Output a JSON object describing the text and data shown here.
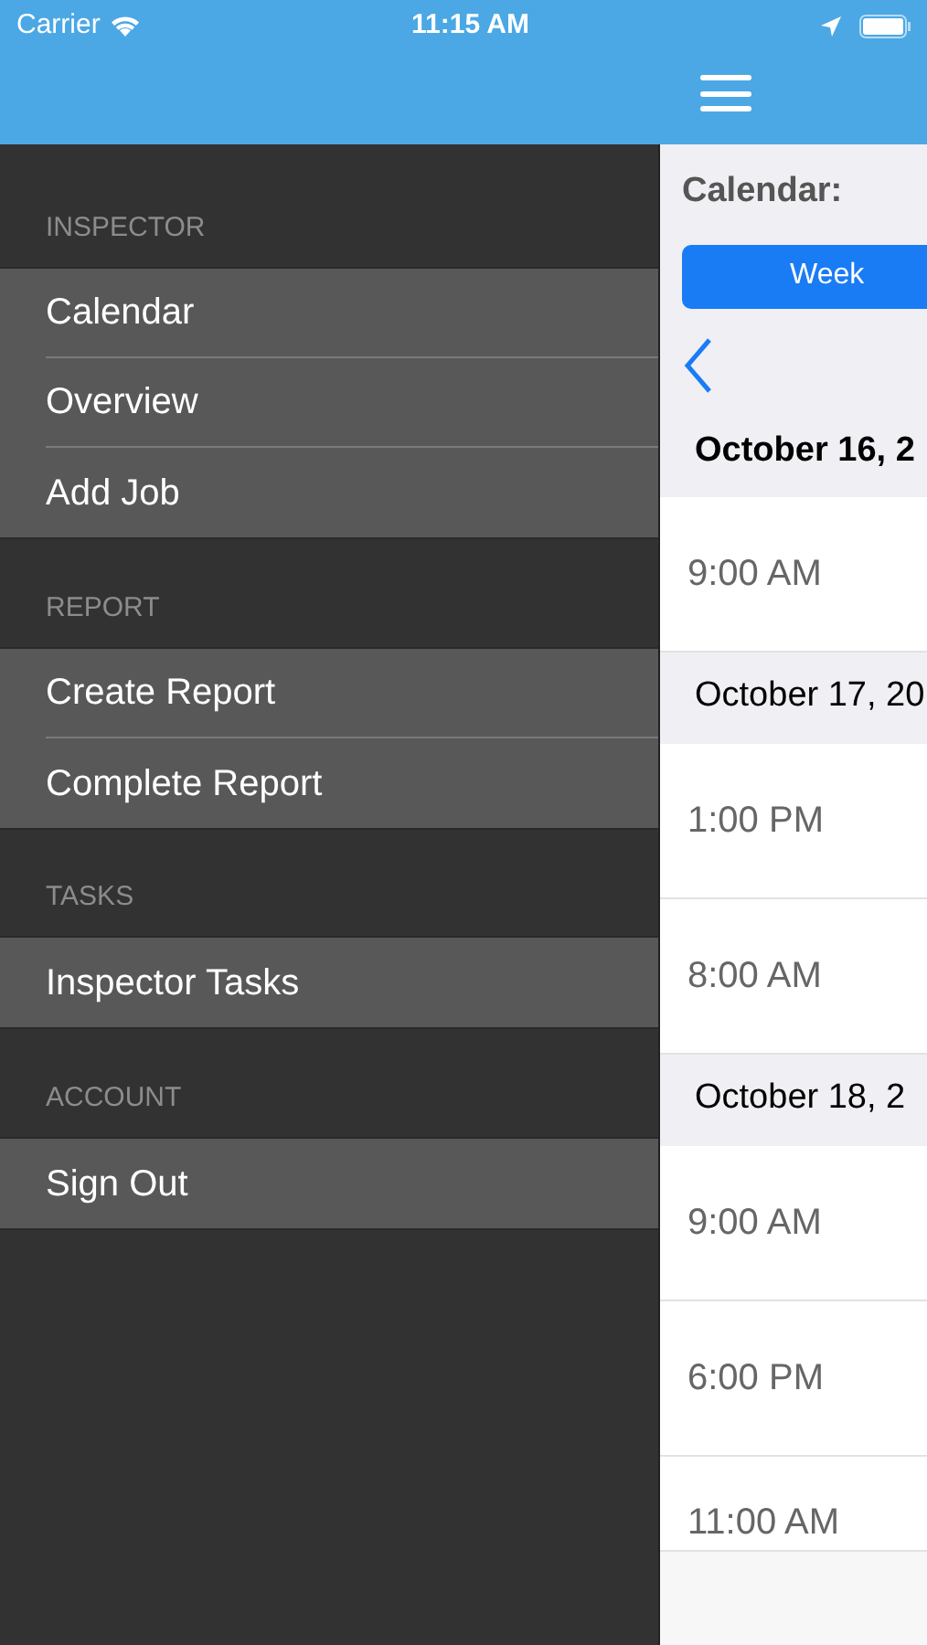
{
  "status_bar": {
    "carrier": "Carrier",
    "time": "11:15 AM"
  },
  "menu": {
    "sections": [
      {
        "title": "INSPECTOR",
        "items": [
          {
            "label": "Calendar"
          },
          {
            "label": "Overview"
          },
          {
            "label": "Add Job"
          }
        ]
      },
      {
        "title": "REPORT",
        "items": [
          {
            "label": "Create Report"
          },
          {
            "label": "Complete Report"
          }
        ]
      },
      {
        "title": "TASKS",
        "items": [
          {
            "label": "Inspector Tasks"
          }
        ]
      },
      {
        "title": "ACCOUNT",
        "items": [
          {
            "label": "Sign Out"
          }
        ]
      }
    ]
  },
  "calendar": {
    "title": "Calendar:",
    "segments": [
      {
        "label": "Week",
        "selected": true
      }
    ],
    "days": [
      {
        "date": "October 16, 2",
        "times": [
          "9:00 AM"
        ]
      },
      {
        "date": "October 17, 20",
        "times": [
          "1:00 PM",
          "8:00 AM"
        ]
      },
      {
        "date": "October 18, 2",
        "times": [
          "9:00 AM",
          "6:00 PM",
          "11:00 AM"
        ]
      }
    ]
  }
}
